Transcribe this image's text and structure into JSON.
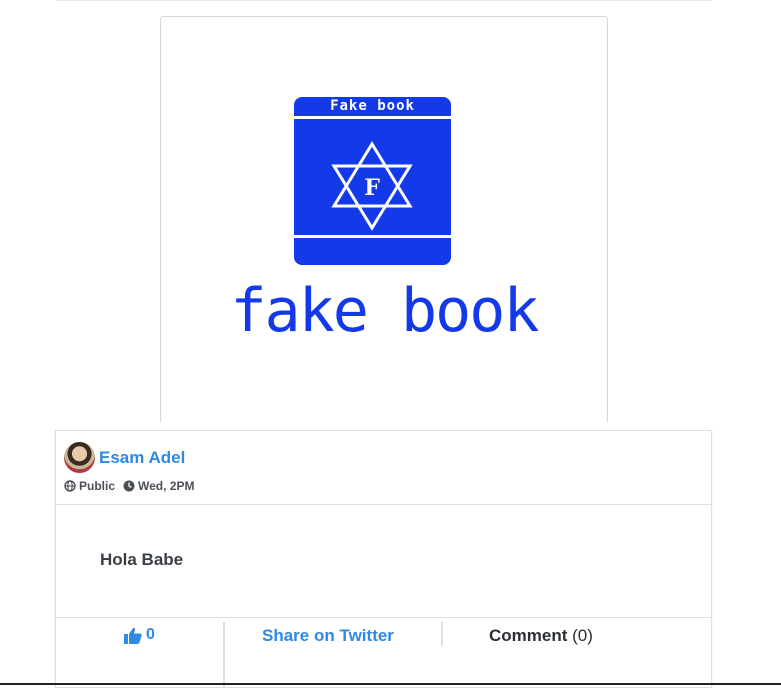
{
  "image_post": {
    "logo_top_label": "Fake book",
    "logo_star_letter": "F",
    "logo_wordmark": "fake book",
    "brand_color": "#1439e8"
  },
  "post": {
    "author": "Esam Adel",
    "privacy": "Public",
    "timestamp": "Wed, 2PM",
    "text": "Hola Babe",
    "like_count": "0",
    "share_label": "Share on Twitter",
    "comment_label": "Comment",
    "comment_count": "(0)"
  },
  "colors": {
    "link_blue": "#2e8ae6",
    "border": "#dcdfe3"
  },
  "icons": [
    "globe-icon",
    "clock-icon",
    "thumbs-up-icon",
    "star-of-david-icon"
  ]
}
